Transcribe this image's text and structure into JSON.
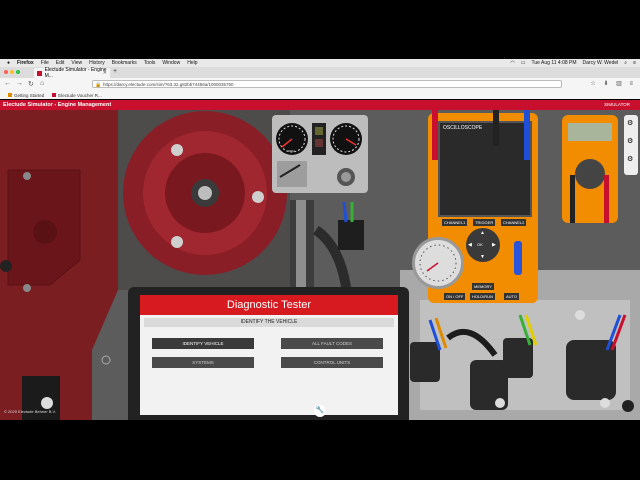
{
  "menubar": {
    "items": [
      "Firefox",
      "File",
      "Edit",
      "View",
      "History",
      "Bookmarks",
      "Tools",
      "Window",
      "Help"
    ],
    "clock": "Tue Aug 11  4:08 PM",
    "user": "Darcy W. Wedel"
  },
  "tab": {
    "title": "Electude Simulator - Engine M..."
  },
  "navbar": {
    "url": "https://darcy.electude.com/sim/?63.32.g82bb74456a/1000035760"
  },
  "bookmarks": {
    "items": [
      "Getting Started",
      "Electude Voucher R..."
    ]
  },
  "app": {
    "title": "Electude Simulator - Engine Management",
    "right_label": "SIMULATOR"
  },
  "oscilloscope": {
    "title": "OSCILLOSCOPE",
    "channel1": "CHANNEL1",
    "trigger": "TRIGGER",
    "channel2": "CHANNEL2",
    "ok": "OK",
    "memory": "MEMORY",
    "onoff": "ON / OFF",
    "holdrun": "HOLD/RUN",
    "auto": "AUTO"
  },
  "gauges": {
    "left_unit": "RPM"
  },
  "tester": {
    "title": "Diagnostic Tester",
    "subtitle": "IDENTIFY THE VEHICLE",
    "buttons": [
      "IDENTIFY VEHICLE",
      "ALL FAULT CODES",
      "SYSTEMS",
      "CONTROL UNITS"
    ]
  },
  "footer": {
    "copyright": "© 2020 Electude Beheer B.V."
  },
  "colors": {
    "brand": "#c8102e",
    "tester_header": "#d71920",
    "meter_orange": "#f28c00"
  }
}
